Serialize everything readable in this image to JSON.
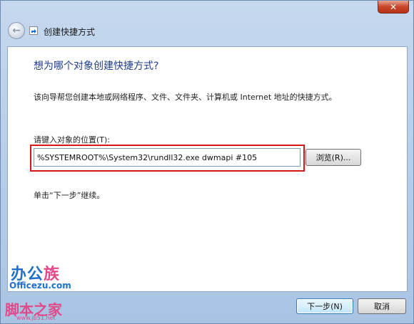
{
  "window": {
    "title": "创建快捷方式",
    "close_symbol": "✕"
  },
  "content": {
    "heading": "想为哪个对象创建快捷方式?",
    "description": "该向导帮您创建本地或网络程序、文件、文件夹、计算机或 Internet 地址的快捷方式。",
    "location_label": "请键入对象的位置(T):",
    "location_value": "%SYSTEMROOT%\\System32\\rundll32.exe dwmapi #105",
    "browse_label": "浏览(R)...",
    "continue_text": "单击“下一步”继续。"
  },
  "footer": {
    "next_label": "下一步(N)",
    "cancel_label": "取消"
  },
  "watermark": {
    "brand_main": "办公",
    "brand_accent": "族",
    "domain": "Officezu.com",
    "site_name": "脚本之家",
    "site_url": "www.jb51.net"
  },
  "colors": {
    "heading": "#1f3d8a",
    "highlight_border": "#d8161a"
  }
}
